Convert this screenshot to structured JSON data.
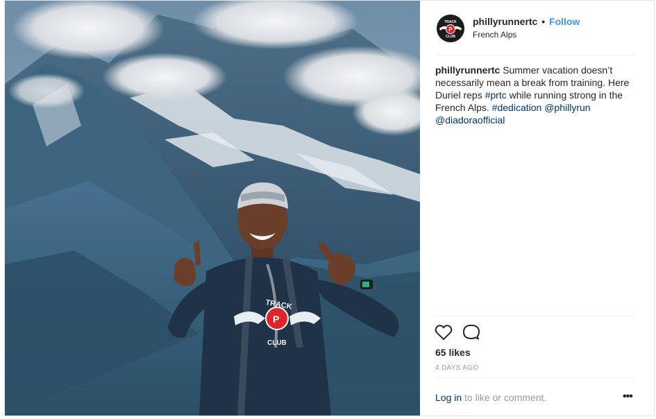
{
  "post": {
    "username": "phillyrunnertc",
    "follow_label": "Follow",
    "separator": "•",
    "location": "French Alps",
    "avatar_text": {
      "top": "TRACK",
      "center": "P",
      "bottom": "CLUB"
    },
    "caption": {
      "username": "phillyrunnertc",
      "text_1": " Summer vacation doesn’t necessarily mean a break from training. Here Duriel reps ",
      "hashtag_1": "#prtc",
      "text_2": " while running strong in the French Alps. ",
      "hashtag_2": "#dedication",
      "text_3": " ",
      "mention_1": "@phillyrun",
      "text_4": " ",
      "mention_2": "@diadoraofficial"
    },
    "actions": {
      "like_icon": "heart-icon",
      "comment_icon": "comment-icon"
    },
    "likes": "65 likes",
    "timestamp": "4 DAYS AGO",
    "login_link": "Log in",
    "login_suffix": " to like or comment.",
    "more_glyph": "•••"
  },
  "shirt_logo": {
    "top": "TRACK",
    "center": "P",
    "bottom": "CLUB"
  },
  "colors": {
    "accent": "#3897f0",
    "link": "#003569",
    "muted": "#999999",
    "text": "#262626",
    "logo_red": "#e0242b"
  }
}
